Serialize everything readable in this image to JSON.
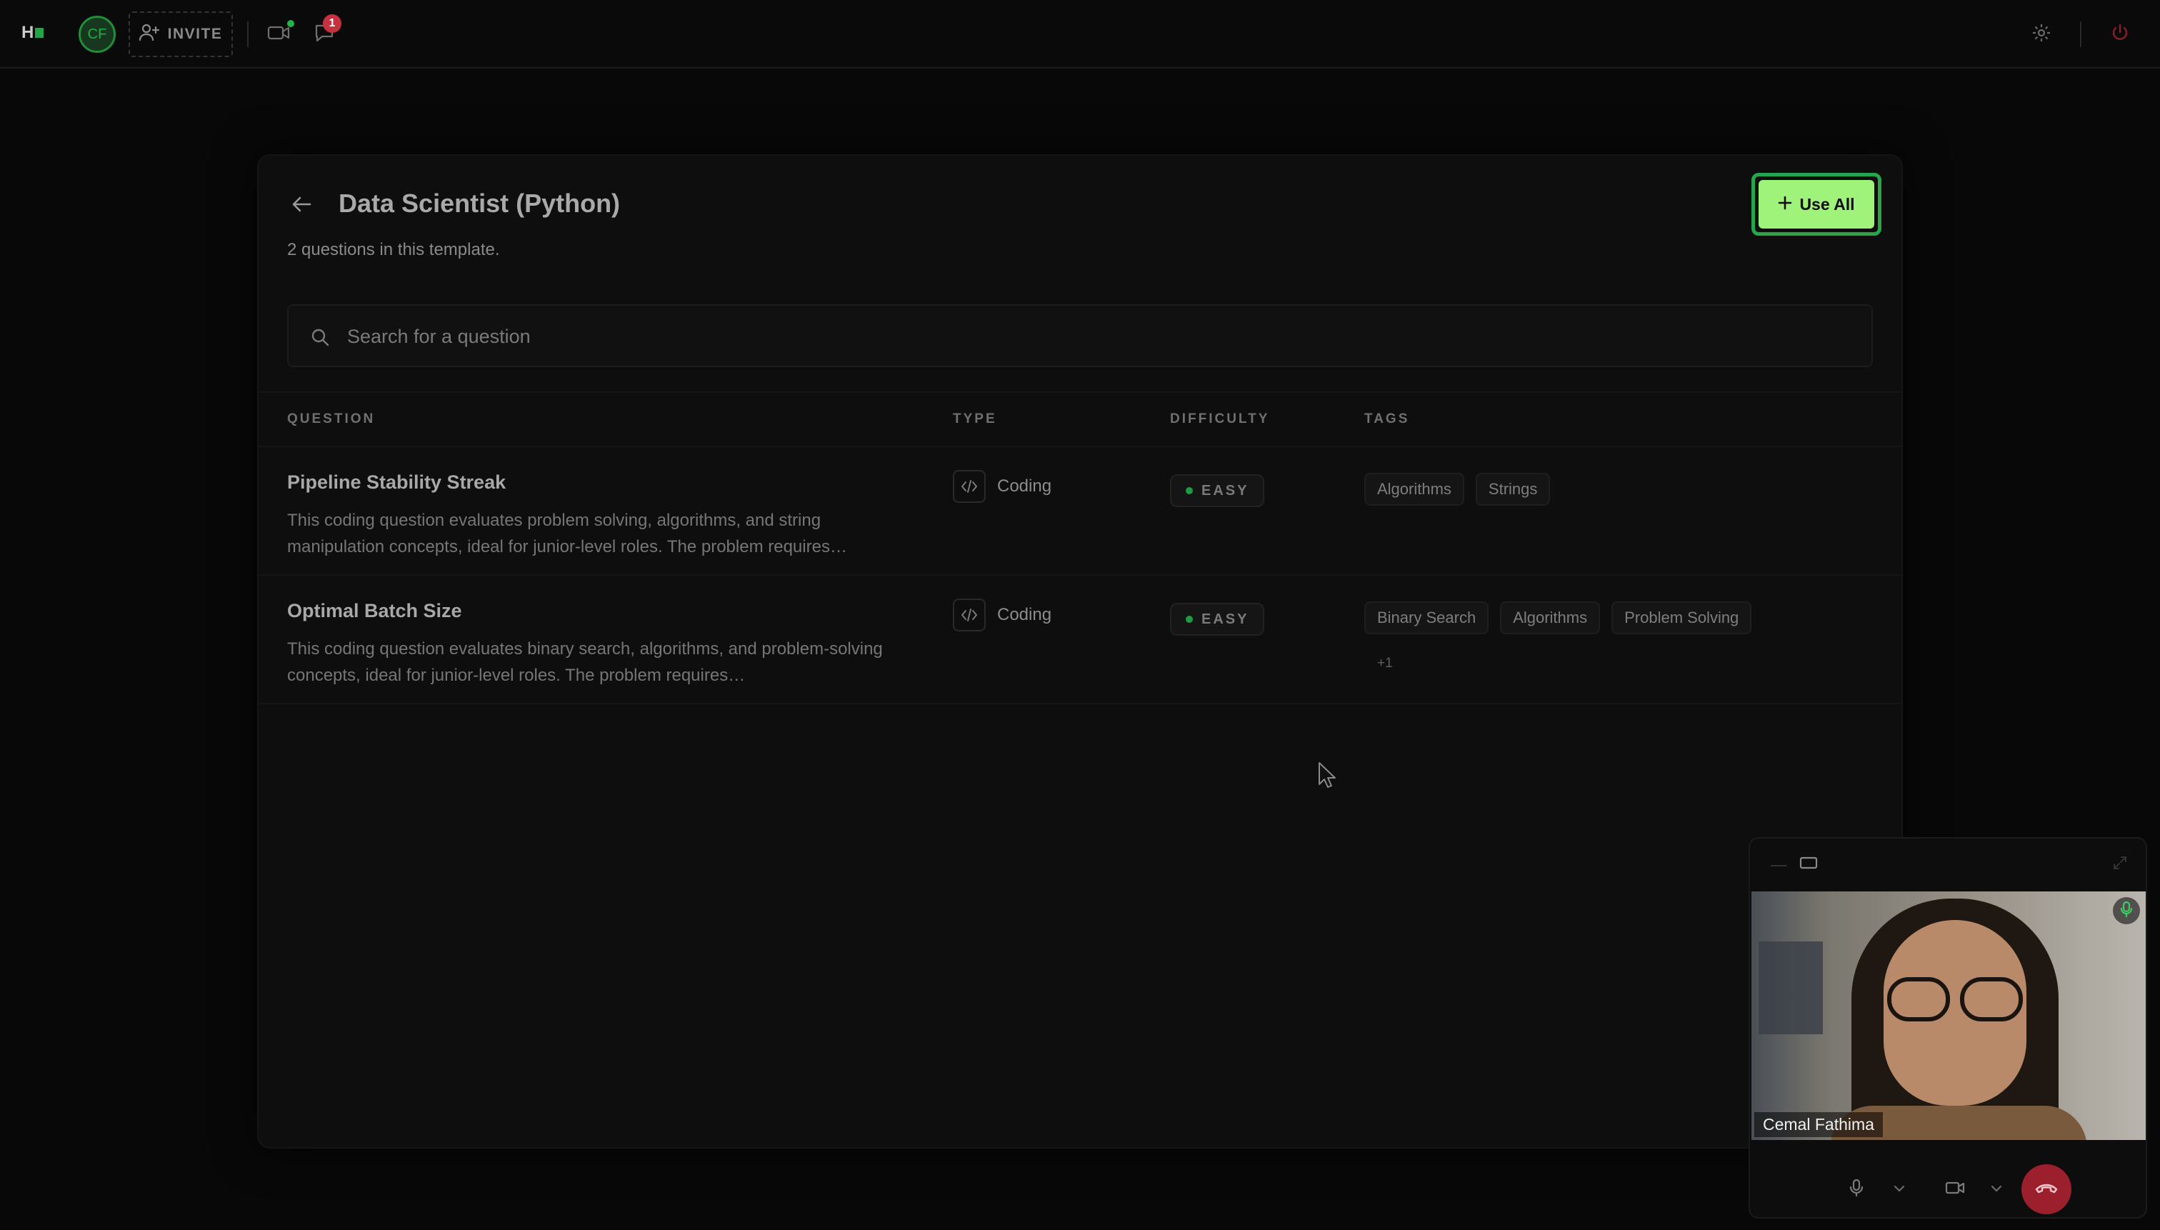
{
  "topbar": {
    "avatar_initials": "CF",
    "invite_label": "INVITE",
    "notification_count": "1"
  },
  "template": {
    "title": "Data Scientist (Python)",
    "subtitle": "2 questions in this template.",
    "use_all_label": "Use All"
  },
  "search": {
    "placeholder": "Search for a question"
  },
  "table": {
    "columns": [
      "QUESTION",
      "TYPE",
      "DIFFICULTY",
      "TAGS"
    ],
    "rows": [
      {
        "title": "Pipeline Stability Streak",
        "description": "This coding question evaluates problem solving, algorithms, and string manipulation concepts, ideal for junior-level roles. The problem requires…",
        "type": "Coding",
        "difficulty": "EASY",
        "tags": [
          "Algorithms",
          "Strings"
        ]
      },
      {
        "title": "Optimal Batch Size",
        "description": "This coding question evaluates binary search, algorithms, and problem-solving concepts, ideal for junior-level roles. The problem requires…",
        "type": "Coding",
        "difficulty": "EASY",
        "tags": [
          "Binary Search",
          "Algorithms",
          "Problem Solving"
        ],
        "more_tags": "+1"
      }
    ]
  },
  "call": {
    "participant_name": "Cemal Fathima"
  },
  "colors": {
    "accent_green": "#9ff27a",
    "focus_ring": "#23a74a",
    "end_call_red": "#9b1f2c",
    "badge_red": "#c6313f"
  },
  "icons": {
    "back": "arrow-left-icon",
    "search": "search-icon",
    "code": "code-icon",
    "settings": "gear-icon",
    "power": "power-icon",
    "video": "video-camera-icon",
    "chat": "chat-bubble-icon",
    "mic": "microphone-icon",
    "hangup": "phone-hangup-icon"
  }
}
